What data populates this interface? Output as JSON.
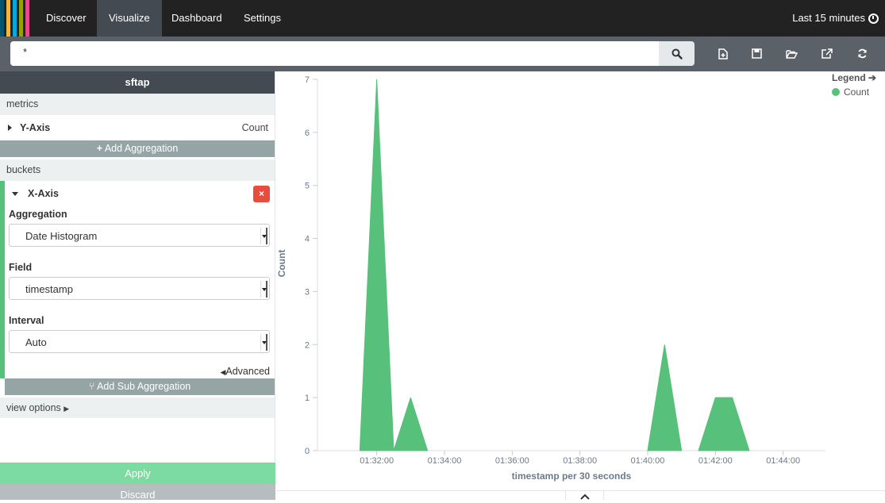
{
  "nav": {
    "logo_colors": [
      "#005571",
      "#f1b73a",
      "#00a9e0",
      "#95a300",
      "#e8478b"
    ],
    "tabs": [
      {
        "label": "Discover"
      },
      {
        "label": "Visualize"
      },
      {
        "label": "Dashboard"
      },
      {
        "label": "Settings"
      }
    ],
    "active_tab": "Visualize",
    "time_range": "Last 15 minutes",
    "time_icon": "clock-icon"
  },
  "search": {
    "query": "*",
    "search_icon": "search-icon",
    "toolbar_icons": [
      "new-visualization-icon",
      "save-icon",
      "open-icon",
      "share-icon",
      "refresh-icon"
    ]
  },
  "sidebar": {
    "index_name": "sftap",
    "metrics_label": "metrics",
    "y_axis": {
      "title": "Y-Axis",
      "value": "Count"
    },
    "add_aggregation": "Add Aggregation",
    "buckets_label": "buckets",
    "x_axis": {
      "title": "X-Axis",
      "remove": "×",
      "aggregation_label": "Aggregation",
      "aggregation_value": "Date Histogram",
      "field_label": "Field",
      "field_value": "timestamp",
      "interval_label": "Interval",
      "interval_value": "Auto",
      "advanced": "Advanced"
    },
    "add_sub_aggregation": "Add Sub Aggregation",
    "view_options": "view options",
    "apply": "Apply",
    "discard": "Discard"
  },
  "legend": {
    "title": "Legend",
    "series": "Count",
    "color": "#57c17b"
  },
  "chart_data": {
    "type": "area",
    "xlabel": "timestamp per 30 seconds",
    "ylabel": "Count",
    "ylim": [
      0,
      7
    ],
    "yticks": [
      0,
      1,
      2,
      3,
      4,
      5,
      6,
      7
    ],
    "xticks": [
      "01:32:00",
      "01:34:00",
      "01:36:00",
      "01:38:00",
      "01:40:00",
      "01:42:00",
      "01:44:00"
    ],
    "x": [
      "01:30:30",
      "01:31:00",
      "01:31:30",
      "01:32:00",
      "01:32:30",
      "01:33:00",
      "01:33:30",
      "01:34:00",
      "01:34:30",
      "01:35:00",
      "01:35:30",
      "01:36:00",
      "01:36:30",
      "01:37:00",
      "01:37:30",
      "01:38:00",
      "01:38:30",
      "01:39:00",
      "01:39:30",
      "01:40:00",
      "01:40:30",
      "01:41:00",
      "01:41:30",
      "01:42:00",
      "01:42:30",
      "01:43:00",
      "01:43:30",
      "01:44:00",
      "01:44:30",
      "01:45:00"
    ],
    "series": [
      {
        "name": "Count",
        "values": [
          0,
          0,
          0,
          7,
          0,
          1,
          0,
          0,
          0,
          0,
          0,
          0,
          0,
          0,
          0,
          0,
          0,
          0,
          0,
          0,
          2,
          0,
          0,
          1,
          1,
          0,
          0,
          0,
          0,
          0
        ]
      }
    ],
    "color": "#57c17b",
    "grid": false,
    "legend_position": "top-right"
  }
}
